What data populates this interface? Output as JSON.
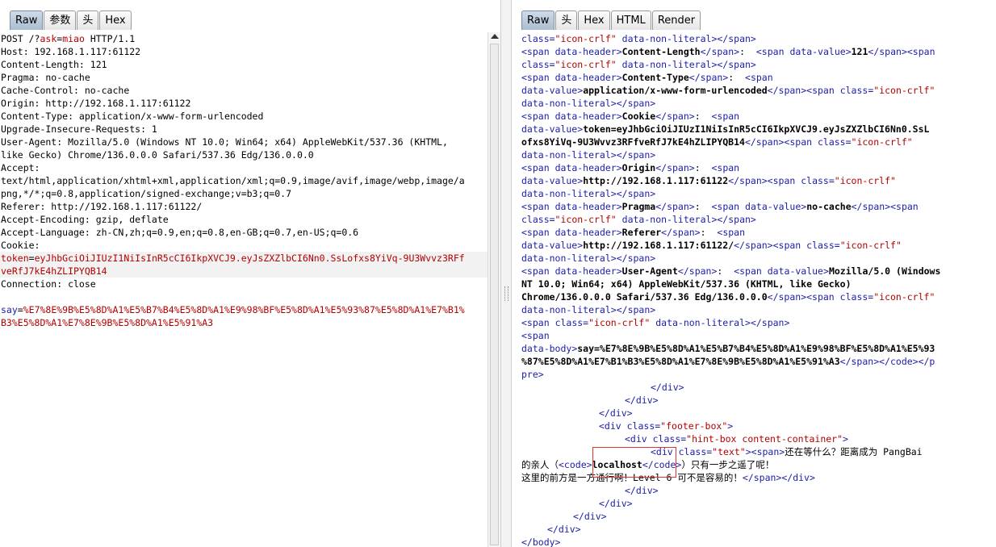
{
  "left_pane": {
    "tabs": [
      "Raw",
      "参数",
      "头",
      "Hex"
    ],
    "active_tab": "Raw",
    "request": {
      "line1_method": "POST /?",
      "line1_param_name": "ask",
      "line1_eq": "=",
      "line1_param_value": "miao",
      "line1_proto": " HTTP/1.1",
      "host": "Host: 192.168.1.117:61122",
      "content_length": "Content-Length: 121",
      "pragma": "Pragma: no-cache",
      "cache_control": "Cache-Control: no-cache",
      "origin": "Origin: http://192.168.1.117:61122",
      "content_type": "Content-Type: application/x-www-form-urlencoded",
      "upgrade": "Upgrade-Insecure-Requests: 1",
      "ua_1": "User-Agent: Mozilla/5.0 (Windows NT 10.0; Win64; x64) AppleWebKit/537.36 (KHTML,",
      "ua_2": "like Gecko) Chrome/136.0.0.0 Safari/537.36 Edg/136.0.0.0",
      "accept_label": "Accept:",
      "accept_1": "text/html,application/xhtml+xml,application/xml;q=0.9,image/avif,image/webp,image/a",
      "accept_2": "png,*/*;q=0.8,application/signed-exchange;v=b3;q=0.7",
      "referer": "Referer: http://192.168.1.117:61122/",
      "accept_encoding": "Accept-Encoding: gzip, deflate",
      "accept_language": "Accept-Language: zh-CN,zh;q=0.9,en;q=0.8,en-GB;q=0.7,en-US;q=0.6",
      "cookie_label": "Cookie:",
      "cookie_name": "token",
      "cookie_eq": "=",
      "cookie_value_1": "eyJhbGciOiJIUzI1NiIsInR5cCI6IkpXVCJ9.eyJsZXZlbCI6Nn0.SsLofxs8YiVq-9U3Wvvz3RFf",
      "cookie_value_2": "veRfJ7kE4hZLIPYQB14",
      "connection": "Connection: close",
      "body_name": "say",
      "body_eq": "=",
      "body_value_1": "%E7%8E%9B%E5%8D%A1%E5%B7%B4%E5%8D%A1%E9%98%BF%E5%8D%A1%E5%93%87%E5%8D%A1%E7%B1%",
      "body_value_2": "B3%E5%8D%A1%E7%8E%9B%E5%8D%A1%E5%91%A3"
    }
  },
  "right_pane": {
    "tabs": [
      "Raw",
      "头",
      "Hex",
      "HTML",
      "Render"
    ],
    "active_tab": "Raw",
    "response": {
      "t_lt": "<",
      "t_gt": ">",
      "t_close_span": "</span>",
      "t_span_open": "<span",
      "t_close_div": "</div>",
      "t_div_open": "<div",
      "t_code_open": "<code>",
      "t_close_code": "</code>",
      "t_close_pre": "pre>",
      "t_close_body": "</body>",
      "a_class": "class=",
      "v_icon_crlf": "\"icon-crlf\"",
      "a_non_literal": "data-non-literal",
      "a_header": "data-header",
      "a_value": "data-value",
      "a_body": "data-body",
      "colon": ": ",
      "h_content_length": "Content-Length",
      "v_121": "121",
      "h_content_type": "Content-Type",
      "v_urlencoded": "application/x-www-form-urlencoded",
      "h_cookie": "Cookie",
      "v_token_1": "token=eyJhbGciOiJIUzI1NiIsInR5cCI6IkpXVCJ9.eyJsZXZlbCI6Nn0.SsL",
      "v_token_2": "ofxs8YiVq-9U3Wvvz3RFfveRfJ7kE4hZLIPYQB14",
      "h_origin": "Origin",
      "v_origin": "http://192.168.1.117:61122",
      "h_pragma": "Pragma",
      "v_no_cache": "no-cache",
      "h_referer": "Referer",
      "v_referer": "http://192.168.1.117:61122/",
      "h_ua": "User-Agent",
      "v_ua_1": "Mozilla/5.0 (Windows",
      "v_ua_2": "NT 10.0; Win64; x64) AppleWebKit/537.36 (KHTML, like Gecko)",
      "v_ua_3": "Chrome/136.0.0.0 Safari/537.36 Edg/136.0.0.0",
      "v_say_1": "say=%E7%8E%9B%E5%8D%A1%E5%B7%B4%E5%8D%A1%E9%98%BF%E5%8D%A1%E5%93",
      "v_say_2": "%87%E5%8D%A1%E7%B1%B3%E5%8D%A1%E7%8E%9B%E5%8D%A1%E5%91%A3",
      "t_close_span_code_p": "</span></code></p",
      "a_class_sp": " class=",
      "v_footer_box": "\"footer-box\"",
      "v_hint_box": "\"hint-box content-container\"",
      "v_text": "\"text\"",
      "t_span_gt": "<span>",
      "hint_text_1": "还在等什么？距离成为 PangBai",
      "hint_text_2a": "的亲人（",
      "code_localhost": "localhost",
      "hint_text_2b": "）只有一步之遥了呢！",
      "hint_text_3": "这里的前方是一方通行啊！Level 6 可不是容易的！",
      "t_close_span_div": "</span></div>"
    }
  }
}
